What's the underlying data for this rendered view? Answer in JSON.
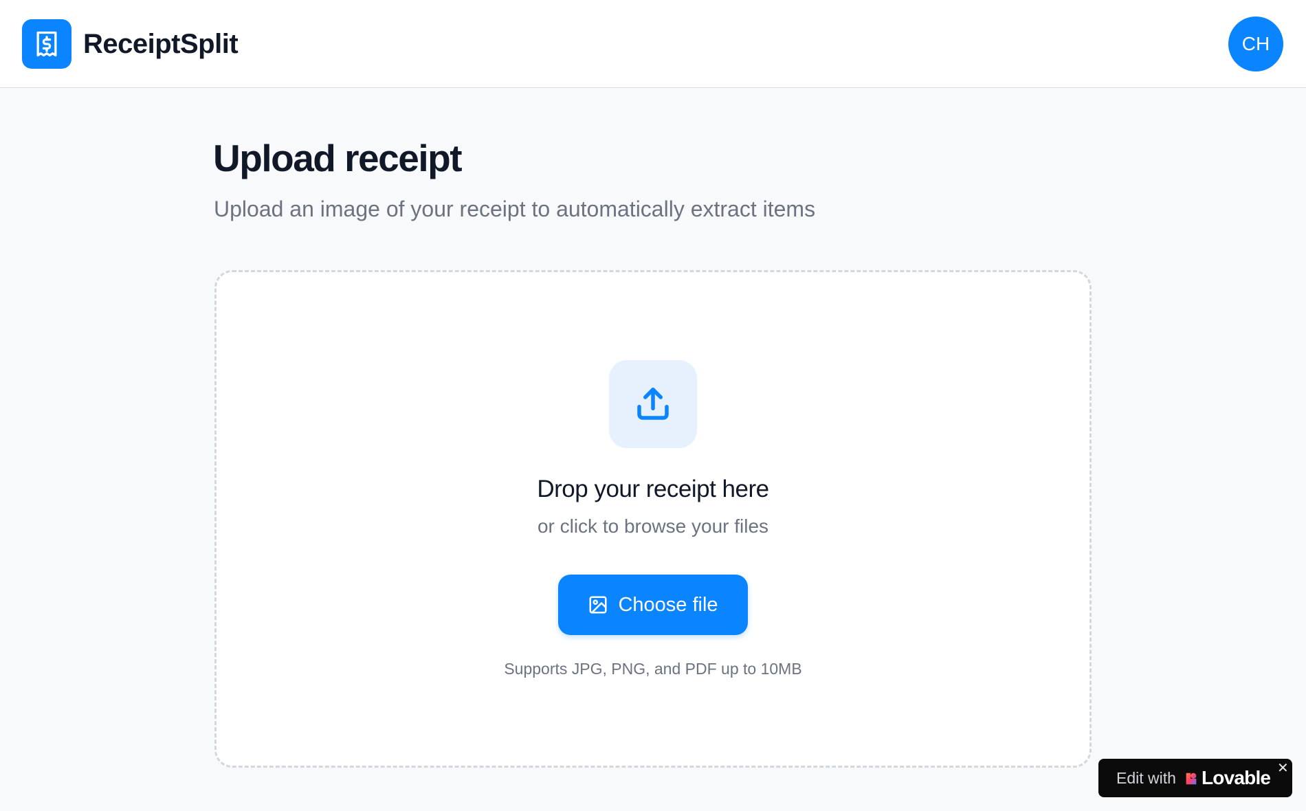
{
  "header": {
    "brand_name": "ReceiptSplit",
    "logo_icon": "receipt-dollar-icon",
    "avatar_initials": "CH"
  },
  "main": {
    "title": "Upload receipt",
    "subtitle": "Upload an image of your receipt to automatically extract items"
  },
  "dropzone": {
    "icon": "upload-icon",
    "title": "Drop your receipt here",
    "subtitle": "or click to browse your files",
    "button_label": "Choose file",
    "button_icon": "image-icon",
    "supports_text": "Supports JPG, PNG, and PDF up to 10MB"
  },
  "badge": {
    "prefix": "Edit with",
    "brand": "Lovable",
    "close_symbol": "✕"
  },
  "colors": {
    "accent": "#0a84ff",
    "background": "#f8f9fb",
    "icon_tint": "#e6f1fd"
  }
}
